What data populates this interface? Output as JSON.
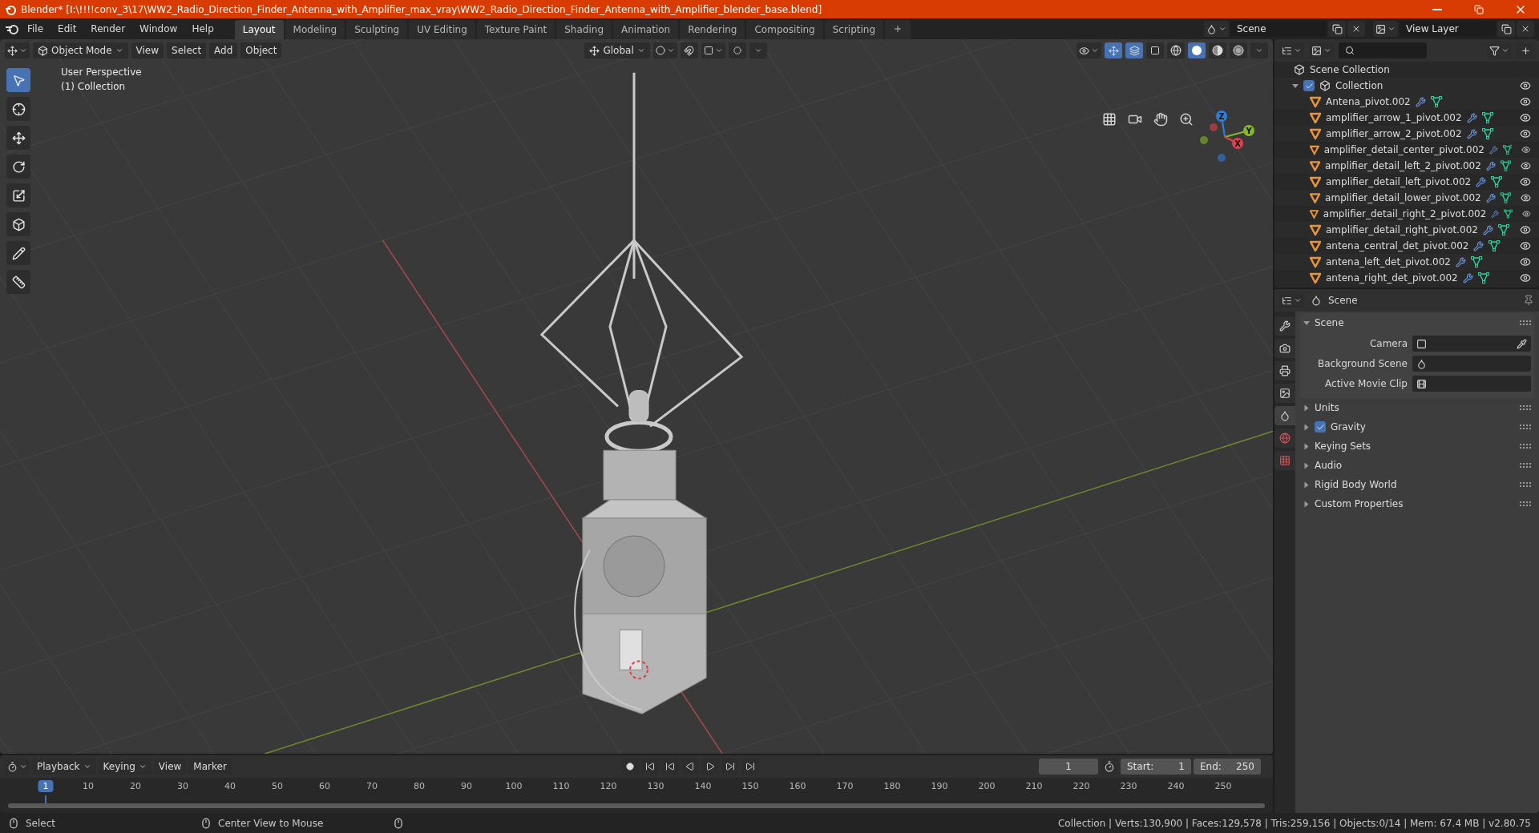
{
  "window": {
    "title": "Blender* [I:\\!!!!conv_3\\17\\WW2_Radio_Direction_Finder_Antenna_with_Amplifier_max_vray\\WW2_Radio_Direction_Finder_Antenna_with_Amplifier_blender_base.blend]"
  },
  "menus": [
    "File",
    "Edit",
    "Render",
    "Window",
    "Help"
  ],
  "workspaces": [
    {
      "label": "Layout",
      "selected": true
    },
    {
      "label": "Modeling",
      "selected": false
    },
    {
      "label": "Sculpting",
      "selected": false
    },
    {
      "label": "UV Editing",
      "selected": false
    },
    {
      "label": "Texture Paint",
      "selected": false
    },
    {
      "label": "Shading",
      "selected": false
    },
    {
      "label": "Animation",
      "selected": false
    },
    {
      "label": "Rendering",
      "selected": false
    },
    {
      "label": "Compositing",
      "selected": false
    },
    {
      "label": "Scripting",
      "selected": false
    }
  ],
  "scene_field": {
    "value": "Scene"
  },
  "view_layer_field": {
    "value": "View Layer"
  },
  "viewport": {
    "mode": "Object Mode",
    "menus": [
      "View",
      "Select",
      "Add",
      "Object"
    ],
    "orientation": "Global",
    "overlay_lines": [
      "User Perspective",
      "(1) Collection"
    ],
    "tools": [
      {
        "kind": "select",
        "selected": true
      },
      {
        "kind": "cursor",
        "selected": false
      },
      {
        "kind": "move",
        "selected": false
      },
      {
        "kind": "rotate",
        "selected": false
      },
      {
        "kind": "scale",
        "selected": false
      },
      {
        "kind": "transform",
        "selected": false
      },
      {
        "kind": "annotate",
        "selected": false
      },
      {
        "kind": "measure",
        "selected": false
      }
    ],
    "shading": [
      {
        "kind": "wireframe",
        "selected": false
      },
      {
        "kind": "solid",
        "selected": true
      },
      {
        "kind": "material",
        "selected": false
      },
      {
        "kind": "rendered",
        "selected": false
      }
    ],
    "gizmo": [
      {
        "label": "Z",
        "color": "#2f7fe0"
      },
      {
        "label": "Y",
        "color": "#86b62c"
      },
      {
        "label": "X",
        "color": "#e0414f"
      }
    ]
  },
  "outliner": {
    "root": "Scene Collection",
    "collection": {
      "label": "Collection",
      "checked": true,
      "expanded": true
    },
    "objects": [
      {
        "label": "Antena_pivot.002"
      },
      {
        "label": "amplifier_arrow_1_pivot.002"
      },
      {
        "label": "amplifier_arrow_2_pivot.002"
      },
      {
        "label": "amplifier_detail_center_pivot.002"
      },
      {
        "label": "amplifier_detail_left_2_pivot.002"
      },
      {
        "label": "amplifier_detail_left_pivot.002"
      },
      {
        "label": "amplifier_detail_lower_pivot.002"
      },
      {
        "label": "amplifier_detail_right_2_pivot.002"
      },
      {
        "label": "amplifier_detail_right_pivot.002"
      },
      {
        "label": "antena_central_det_pivot.002"
      },
      {
        "label": "antena_left_det_pivot.002"
      },
      {
        "label": "antena_right_det_pivot.002"
      }
    ]
  },
  "properties": {
    "context": "Scene",
    "tabs": [
      {
        "kind": "tool",
        "selected": false
      },
      {
        "kind": "render",
        "selected": false
      },
      {
        "kind": "output",
        "selected": false
      },
      {
        "kind": "view_layer",
        "selected": false
      },
      {
        "kind": "scene",
        "selected": true
      },
      {
        "kind": "world",
        "selected": false
      },
      {
        "kind": "texture",
        "selected": false
      }
    ],
    "panels": [
      {
        "label": "Scene",
        "kind": "plain",
        "expanded": true,
        "fields": [
          {
            "label": "Camera",
            "kind": "camera"
          },
          {
            "label": "Background Scene",
            "kind": "scene"
          },
          {
            "label": "Active Movie Clip",
            "kind": "clip"
          }
        ]
      },
      {
        "label": "Units",
        "kind": "plain",
        "expanded": false
      },
      {
        "label": "Gravity",
        "kind": "checkbox",
        "checked": true,
        "expanded": false
      },
      {
        "label": "Keying Sets",
        "kind": "plain",
        "expanded": false
      },
      {
        "label": "Audio",
        "kind": "plain",
        "expanded": false
      },
      {
        "label": "Rigid Body World",
        "kind": "plain",
        "expanded": false
      },
      {
        "label": "Custom Properties",
        "kind": "plain",
        "expanded": false
      }
    ]
  },
  "timeline": {
    "menus": [
      "Playback",
      "Keying",
      "View",
      "Marker"
    ],
    "current_frame": "1",
    "start_label": "Start:",
    "start": "1",
    "end_label": "End:",
    "end": "250",
    "ticks": [
      {
        "label": "1",
        "selected": true
      },
      {
        "label": "10",
        "selected": false
      },
      {
        "label": "20",
        "selected": false
      },
      {
        "label": "30",
        "selected": false
      },
      {
        "label": "40",
        "selected": false
      },
      {
        "label": "50",
        "selected": false
      },
      {
        "label": "60",
        "selected": false
      },
      {
        "label": "70",
        "selected": false
      },
      {
        "label": "80",
        "selected": false
      },
      {
        "label": "90",
        "selected": false
      },
      {
        "label": "100",
        "selected": false
      },
      {
        "label": "110",
        "selected": false
      },
      {
        "label": "120",
        "selected": false
      },
      {
        "label": "130",
        "selected": false
      },
      {
        "label": "140",
        "selected": false
      },
      {
        "label": "150",
        "selected": false
      },
      {
        "label": "160",
        "selected": false
      },
      {
        "label": "170",
        "selected": false
      },
      {
        "label": "180",
        "selected": false
      },
      {
        "label": "190",
        "selected": false
      },
      {
        "label": "200",
        "selected": false
      },
      {
        "label": "210",
        "selected": false
      },
      {
        "label": "220",
        "selected": false
      },
      {
        "label": "230",
        "selected": false
      },
      {
        "label": "240",
        "selected": false
      },
      {
        "label": "250",
        "selected": false
      }
    ]
  },
  "status": {
    "hints": [
      "Select",
      "Center View to Mouse"
    ],
    "stats": "Collection | Verts:130,900 | Faces:129,578 | Tris:259,156 | Objects:0/14 | Mem: 67.4 MB | v2.80.75"
  }
}
